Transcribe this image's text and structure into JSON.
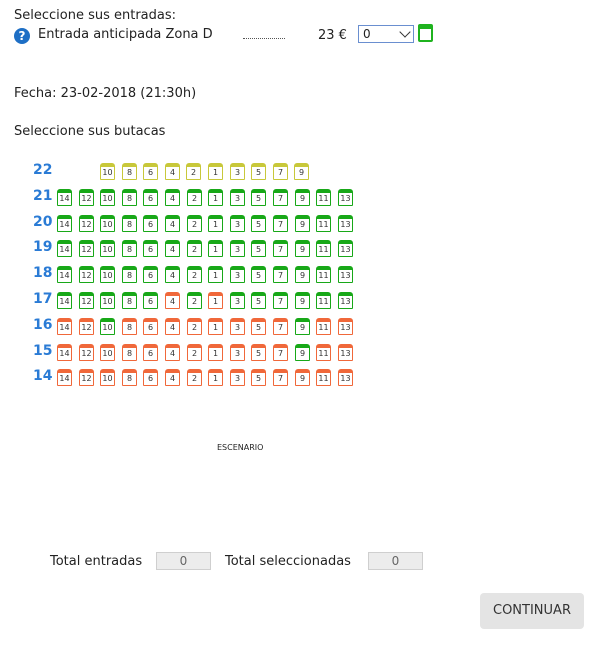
{
  "tickets": {
    "heading": "Seleccione sus entradas:",
    "help_icon": "?",
    "item_label": "Entrada anticipada Zona D",
    "price": "23 €",
    "qty_value": "0"
  },
  "date_text": "Fecha: 23-02-2018 (21:30h)",
  "seats_heading": "Seleccione sus butacas",
  "colors": {
    "available": "#18a818",
    "occupied": "#f0683a",
    "selected": "#c8c83a",
    "row_label": "#2a7bd5"
  },
  "seat_map": {
    "rows": [
      {
        "label": "22",
        "seats": [
          {
            "n": "10",
            "s": "y"
          },
          {
            "n": "8",
            "s": "y"
          },
          {
            "n": "6",
            "s": "y"
          },
          {
            "n": "4",
            "s": "y"
          },
          {
            "n": "2",
            "s": "y"
          },
          {
            "n": "1",
            "s": "y"
          },
          {
            "n": "3",
            "s": "y"
          },
          {
            "n": "5",
            "s": "y"
          },
          {
            "n": "7",
            "s": "y"
          },
          {
            "n": "9",
            "s": "y"
          }
        ]
      },
      {
        "label": "21",
        "seats": [
          {
            "n": "14",
            "s": "g"
          },
          {
            "n": "12",
            "s": "g"
          },
          {
            "n": "10",
            "s": "g"
          },
          {
            "n": "8",
            "s": "g"
          },
          {
            "n": "6",
            "s": "g"
          },
          {
            "n": "4",
            "s": "g"
          },
          {
            "n": "2",
            "s": "g"
          },
          {
            "n": "1",
            "s": "g"
          },
          {
            "n": "3",
            "s": "g"
          },
          {
            "n": "5",
            "s": "g"
          },
          {
            "n": "7",
            "s": "g"
          },
          {
            "n": "9",
            "s": "g"
          },
          {
            "n": "11",
            "s": "g"
          },
          {
            "n": "13",
            "s": "g"
          }
        ]
      },
      {
        "label": "20",
        "seats": [
          {
            "n": "14",
            "s": "g"
          },
          {
            "n": "12",
            "s": "g"
          },
          {
            "n": "10",
            "s": "g"
          },
          {
            "n": "8",
            "s": "g"
          },
          {
            "n": "6",
            "s": "g"
          },
          {
            "n": "4",
            "s": "g"
          },
          {
            "n": "2",
            "s": "g"
          },
          {
            "n": "1",
            "s": "g"
          },
          {
            "n": "3",
            "s": "g"
          },
          {
            "n": "5",
            "s": "g"
          },
          {
            "n": "7",
            "s": "g"
          },
          {
            "n": "9",
            "s": "g"
          },
          {
            "n": "11",
            "s": "g"
          },
          {
            "n": "13",
            "s": "g"
          }
        ]
      },
      {
        "label": "19",
        "seats": [
          {
            "n": "14",
            "s": "g"
          },
          {
            "n": "12",
            "s": "g"
          },
          {
            "n": "10",
            "s": "g"
          },
          {
            "n": "8",
            "s": "g"
          },
          {
            "n": "6",
            "s": "g"
          },
          {
            "n": "4",
            "s": "g"
          },
          {
            "n": "2",
            "s": "g"
          },
          {
            "n": "1",
            "s": "g"
          },
          {
            "n": "3",
            "s": "g"
          },
          {
            "n": "5",
            "s": "g"
          },
          {
            "n": "7",
            "s": "g"
          },
          {
            "n": "9",
            "s": "g"
          },
          {
            "n": "11",
            "s": "g"
          },
          {
            "n": "13",
            "s": "g"
          }
        ]
      },
      {
        "label": "18",
        "seats": [
          {
            "n": "14",
            "s": "g"
          },
          {
            "n": "12",
            "s": "g"
          },
          {
            "n": "10",
            "s": "g"
          },
          {
            "n": "8",
            "s": "g"
          },
          {
            "n": "6",
            "s": "g"
          },
          {
            "n": "4",
            "s": "g"
          },
          {
            "n": "2",
            "s": "g"
          },
          {
            "n": "1",
            "s": "g"
          },
          {
            "n": "3",
            "s": "g"
          },
          {
            "n": "5",
            "s": "g"
          },
          {
            "n": "7",
            "s": "g"
          },
          {
            "n": "9",
            "s": "g"
          },
          {
            "n": "11",
            "s": "g"
          },
          {
            "n": "13",
            "s": "g"
          }
        ]
      },
      {
        "label": "17",
        "seats": [
          {
            "n": "14",
            "s": "g"
          },
          {
            "n": "12",
            "s": "g"
          },
          {
            "n": "10",
            "s": "g"
          },
          {
            "n": "8",
            "s": "g"
          },
          {
            "n": "6",
            "s": "g"
          },
          {
            "n": "4",
            "s": "o"
          },
          {
            "n": "2",
            "s": "g"
          },
          {
            "n": "1",
            "s": "o"
          },
          {
            "n": "3",
            "s": "g"
          },
          {
            "n": "5",
            "s": "g"
          },
          {
            "n": "7",
            "s": "g"
          },
          {
            "n": "9",
            "s": "g"
          },
          {
            "n": "11",
            "s": "g"
          },
          {
            "n": "13",
            "s": "g"
          }
        ]
      },
      {
        "label": "16",
        "seats": [
          {
            "n": "14",
            "s": "o"
          },
          {
            "n": "12",
            "s": "o"
          },
          {
            "n": "10",
            "s": "g"
          },
          {
            "n": "8",
            "s": "o"
          },
          {
            "n": "6",
            "s": "o"
          },
          {
            "n": "4",
            "s": "o"
          },
          {
            "n": "2",
            "s": "o"
          },
          {
            "n": "1",
            "s": "o"
          },
          {
            "n": "3",
            "s": "o"
          },
          {
            "n": "5",
            "s": "o"
          },
          {
            "n": "7",
            "s": "o"
          },
          {
            "n": "9",
            "s": "g"
          },
          {
            "n": "11",
            "s": "o"
          },
          {
            "n": "13",
            "s": "o"
          }
        ]
      },
      {
        "label": "15",
        "seats": [
          {
            "n": "14",
            "s": "o"
          },
          {
            "n": "12",
            "s": "o"
          },
          {
            "n": "10",
            "s": "o"
          },
          {
            "n": "8",
            "s": "o"
          },
          {
            "n": "6",
            "s": "o"
          },
          {
            "n": "4",
            "s": "o"
          },
          {
            "n": "2",
            "s": "o"
          },
          {
            "n": "1",
            "s": "o"
          },
          {
            "n": "3",
            "s": "o"
          },
          {
            "n": "5",
            "s": "o"
          },
          {
            "n": "7",
            "s": "o"
          },
          {
            "n": "9",
            "s": "g"
          },
          {
            "n": "11",
            "s": "o"
          },
          {
            "n": "13",
            "s": "o"
          }
        ]
      },
      {
        "label": "14",
        "seats": [
          {
            "n": "14",
            "s": "o"
          },
          {
            "n": "12",
            "s": "o"
          },
          {
            "n": "10",
            "s": "o"
          },
          {
            "n": "8",
            "s": "o"
          },
          {
            "n": "6",
            "s": "o"
          },
          {
            "n": "4",
            "s": "o"
          },
          {
            "n": "2",
            "s": "o"
          },
          {
            "n": "1",
            "s": "o"
          },
          {
            "n": "3",
            "s": "o"
          },
          {
            "n": "5",
            "s": "o"
          },
          {
            "n": "7",
            "s": "o"
          },
          {
            "n": "9",
            "s": "o"
          },
          {
            "n": "11",
            "s": "o"
          },
          {
            "n": "13",
            "s": "o"
          }
        ]
      }
    ]
  },
  "stage_label": "ESCENARIO",
  "totals": {
    "entradas_label": "Total entradas",
    "entradas_value": "0",
    "seleccionadas_label": "Total seleccionadas",
    "seleccionadas_value": "0"
  },
  "continue_label": "CONTINUAR"
}
